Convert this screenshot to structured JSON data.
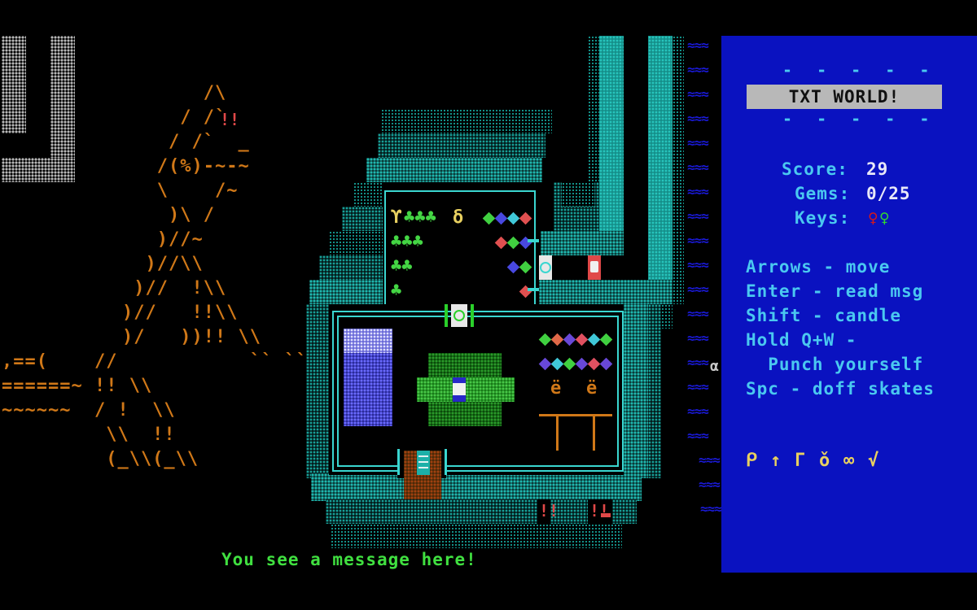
{
  "game": {
    "title": "TXT WORLD!",
    "message": "You see a message here!"
  },
  "stats": {
    "score_label": "Score:",
    "score_value": "29",
    "gems_label": "Gems:",
    "gems_value": "0/25",
    "gems_collected": 0,
    "gems_total": 25,
    "keys_label": "Keys:",
    "keys": [
      {
        "glyph": "♀",
        "color": "#d81818",
        "name": "red-key"
      },
      {
        "glyph": "♀",
        "color": "#30d830",
        "name": "green-key"
      }
    ]
  },
  "controls": [
    "Arrows - move",
    "Enter - read msg",
    "Shift - candle",
    "Hold Q+W -",
    "  Punch yourself",
    "Spc - doff skates"
  ],
  "inventory": [
    "ᑭ",
    "↑",
    "Γ",
    "ǒ",
    "∞",
    "√"
  ],
  "banner_dashes": "- - - - -",
  "map": {
    "tower_ascii": [
      "       /\\",
      "     / /`",
      "    / /`  _",
      "   /(%)-~-~",
      "   \\    /~",
      "    )\\ /",
      "   )//~",
      "  )//\\\\",
      " )//  !\\\\",
      ")//   !!\\\\",
      ")/   ))!! \\\\",
      "           `` ``"
    ],
    "tower_base_ascii": [
      ",==(    //",
      "======~ !! \\\\",
      "~~~~~~  / !  \\\\",
      "         \\\\  !!",
      "         (_\\\\(_\\\\"
    ],
    "tree_rows": [
      3,
      3,
      2,
      1
    ],
    "gamma_glyph": "ϒ",
    "delta_glyph": "δ",
    "chair_glyph": "ë",
    "alpha_glyph": "α",
    "water_glyph": "≈≈≈",
    "exclaim_glyph": "!!",
    "gems_top_room": [
      [
        "#40d040",
        "#4848e0",
        "#40c8d8",
        "#e05050"
      ],
      [
        "#e05050",
        "#40d040",
        "#4848e0"
      ],
      [
        "#4848e0",
        "#40d040"
      ],
      [
        "#e05050"
      ]
    ],
    "gems_main_room": [
      [
        "#40d040",
        "#e06848",
        "#6848d8",
        "#e05060",
        "#40c8d8",
        "#40d040"
      ],
      [
        "#6848d8",
        "#40c8d8",
        "#40d040",
        "#6848d8",
        "#e05060",
        "#6848d8"
      ]
    ]
  }
}
